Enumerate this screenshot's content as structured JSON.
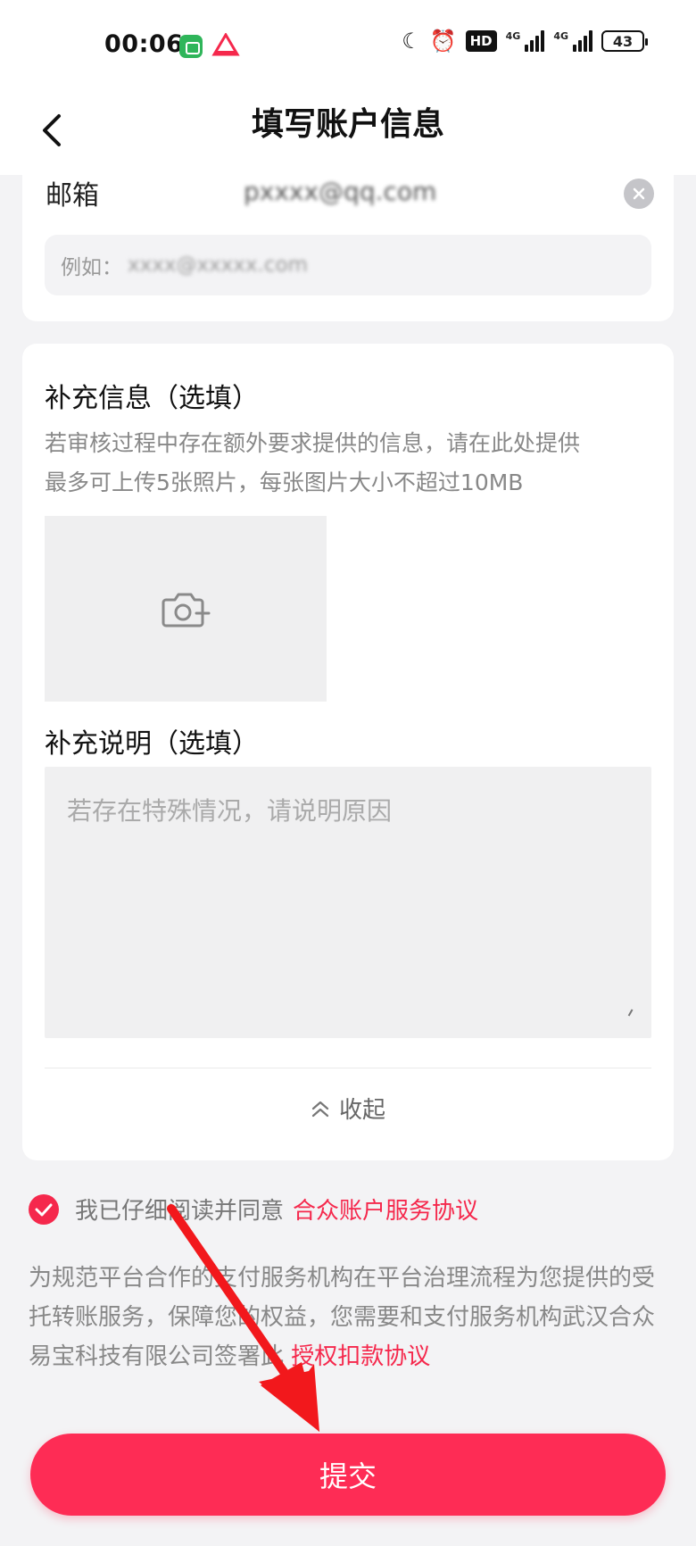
{
  "status_bar": {
    "time": "00:06",
    "hd_badge": "HD",
    "net_label_1": "4G",
    "net_label_2": "4G",
    "battery": "43",
    "icons": [
      "moon-icon",
      "alarm-icon",
      "hd-icon",
      "signal-icon",
      "battery-icon"
    ]
  },
  "header": {
    "title": "填写账户信息"
  },
  "email": {
    "label": "邮箱",
    "value": "pxxxx@qq.com",
    "input_prefix": "例如：",
    "input_example": "xxxx@xxxxx.com"
  },
  "extra": {
    "info_title": "补充信息（选填）",
    "info_hint_1": "若审核过程中存在额外要求提供的信息，请在此处提供",
    "info_hint_2": "最多可上传5张照片，每张图片大小不超过10MB",
    "note_title": "补充说明（选填）",
    "note_placeholder": "若存在特殊情况，请说明原因",
    "collapse_label": "收起"
  },
  "agreement": {
    "text": "我已仔细阅读并同意",
    "link": "合众账户服务协议"
  },
  "notice": {
    "text": "为规范平台合作的支付服务机构在平台治理流程为您提供的受托转账服务，保障您的权益，您需要和支付服务机构武汉合众易宝科技有限公司签署此",
    "link": "授权扣款协议"
  },
  "submit": {
    "label": "提交"
  },
  "colors": {
    "accent": "#fe2c55",
    "link": "#f5284c",
    "background": "#f3f3f5"
  }
}
